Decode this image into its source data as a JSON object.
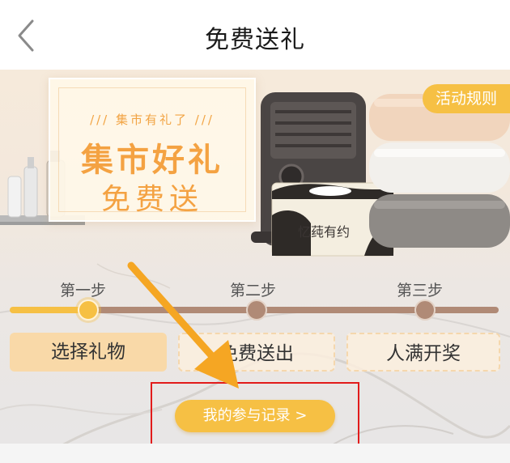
{
  "nav": {
    "title": "免费送礼",
    "back_icon": "chevron-left-icon"
  },
  "banner": {
    "poster_subtitle": "/// 集市有礼了 ///",
    "poster_title_line1": "集市好礼",
    "poster_title_line2": "免费送",
    "rules_button": "活动规则",
    "product_brand": "忆莼有约"
  },
  "steps": {
    "items": [
      {
        "label": "第一步",
        "action": "选择礼物",
        "state": "active"
      },
      {
        "label": "第二步",
        "action": "免费送出",
        "state": "inactive"
      },
      {
        "label": "第三步",
        "action": "人满开奖",
        "state": "inactive"
      }
    ],
    "progress": 0.0
  },
  "records_button": "我的参与记录 >",
  "colors": {
    "accent": "#f6c044",
    "track_inactive": "#b08a76",
    "poster_text": "#f4a242",
    "annotation_box": "#e21b1b",
    "annotation_arrow": "#f5a623"
  }
}
